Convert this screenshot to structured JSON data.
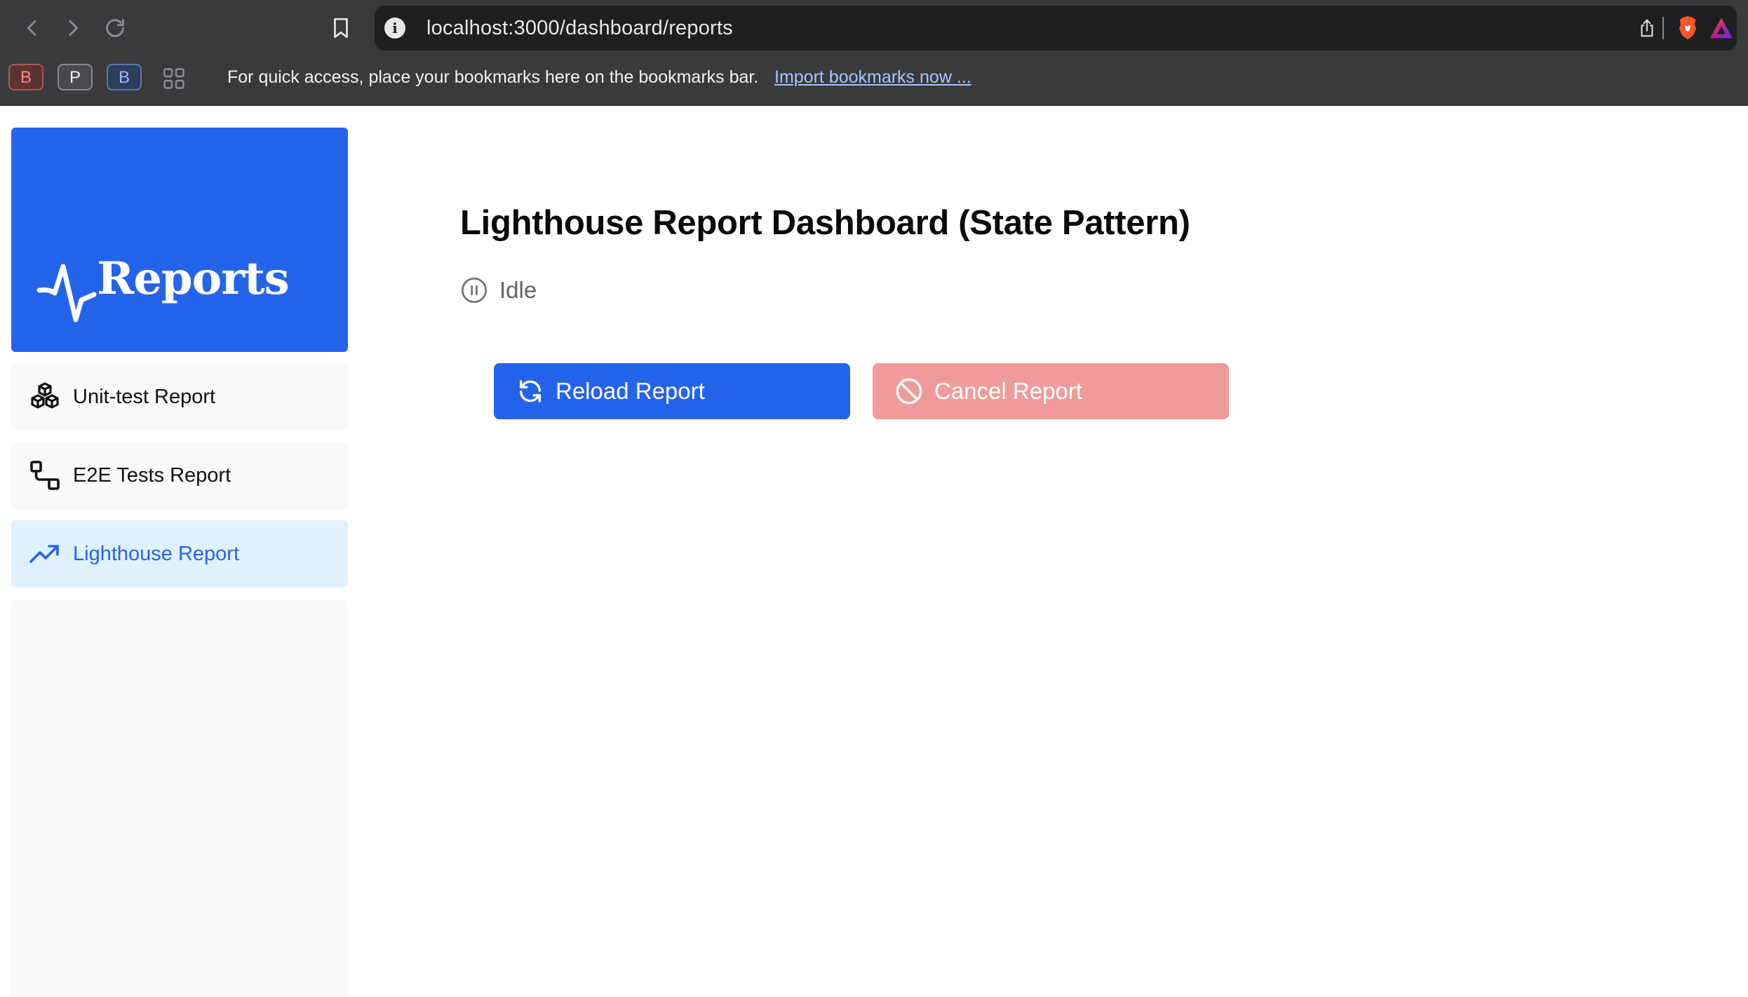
{
  "browser": {
    "url": "localhost:3000/dashboard/reports",
    "url_info_glyph": "i",
    "profiles": [
      "B",
      "P",
      "B"
    ],
    "bookmarks_hint": "For quick access, place your bookmarks here on the bookmarks bar.",
    "import_link": "Import bookmarks now ...",
    "icons": [
      "back-arrow-icon",
      "forward-arrow-icon",
      "reload-icon",
      "bookmark-icon",
      "info-icon",
      "share-icon",
      "brave-lion-icon",
      "brave-rewards-icon",
      "apps-grid-icon"
    ]
  },
  "sidebar": {
    "logo_text": "Reports",
    "logo_icon": "activity-pulse-icon",
    "items": [
      {
        "label": "Unit-test Report",
        "icon": "cubes-icon",
        "active": false
      },
      {
        "label": "E2E Tests Report",
        "icon": "flow-squares-icon",
        "active": false
      },
      {
        "label": "Lighthouse Report",
        "icon": "trending-up-icon",
        "active": true
      }
    ]
  },
  "main": {
    "title": "Lighthouse Report Dashboard (State Pattern)",
    "status": {
      "label": "Idle",
      "icon": "pause-circle-icon"
    },
    "buttons": {
      "reload": {
        "label": "Reload Report",
        "icon": "refresh-icon"
      },
      "cancel": {
        "label": "Cancel Report",
        "icon": "ban-icon"
      }
    }
  },
  "colors": {
    "accent": "#2563eb",
    "active_bg": "#e0f1fe",
    "sidebar_bg": "#f8f9fa",
    "cancel_disabled": "#f09b9b",
    "chrome_bg": "#3a3a3d"
  }
}
